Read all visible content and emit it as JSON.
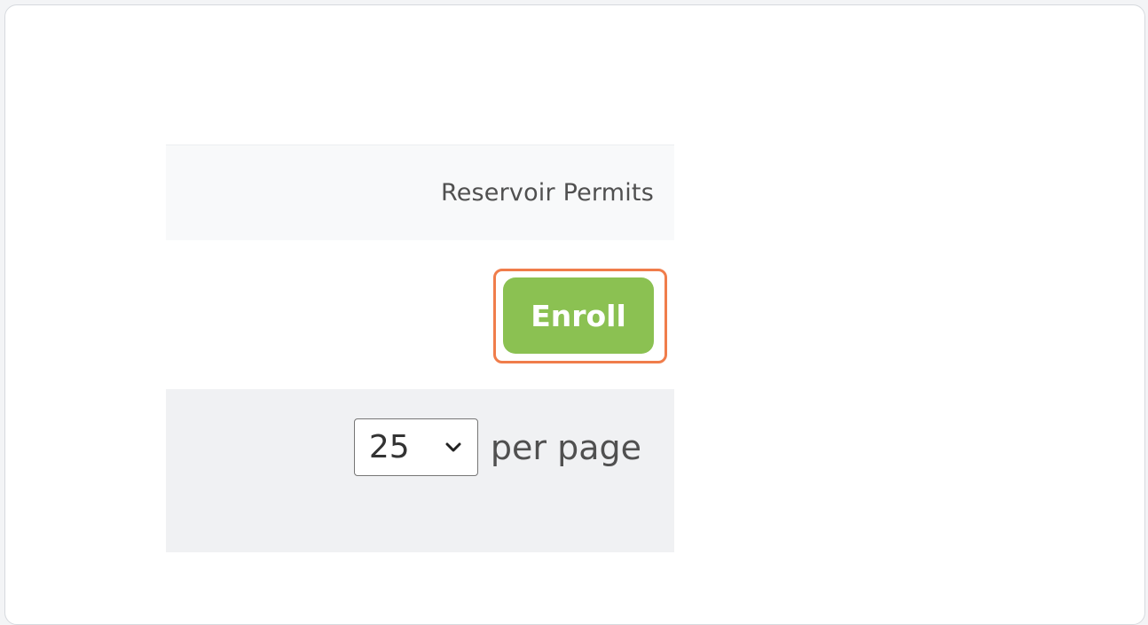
{
  "section": {
    "title": "Reservoir Permits"
  },
  "actions": {
    "enroll_label": "Enroll"
  },
  "pagination": {
    "page_size_value": "25",
    "page_size_suffix": "per page"
  },
  "colors": {
    "enroll_button": "#8bc152",
    "highlight_outline": "#f07d4b"
  },
  "icons": {
    "dropdown": "chevron-down-icon"
  }
}
